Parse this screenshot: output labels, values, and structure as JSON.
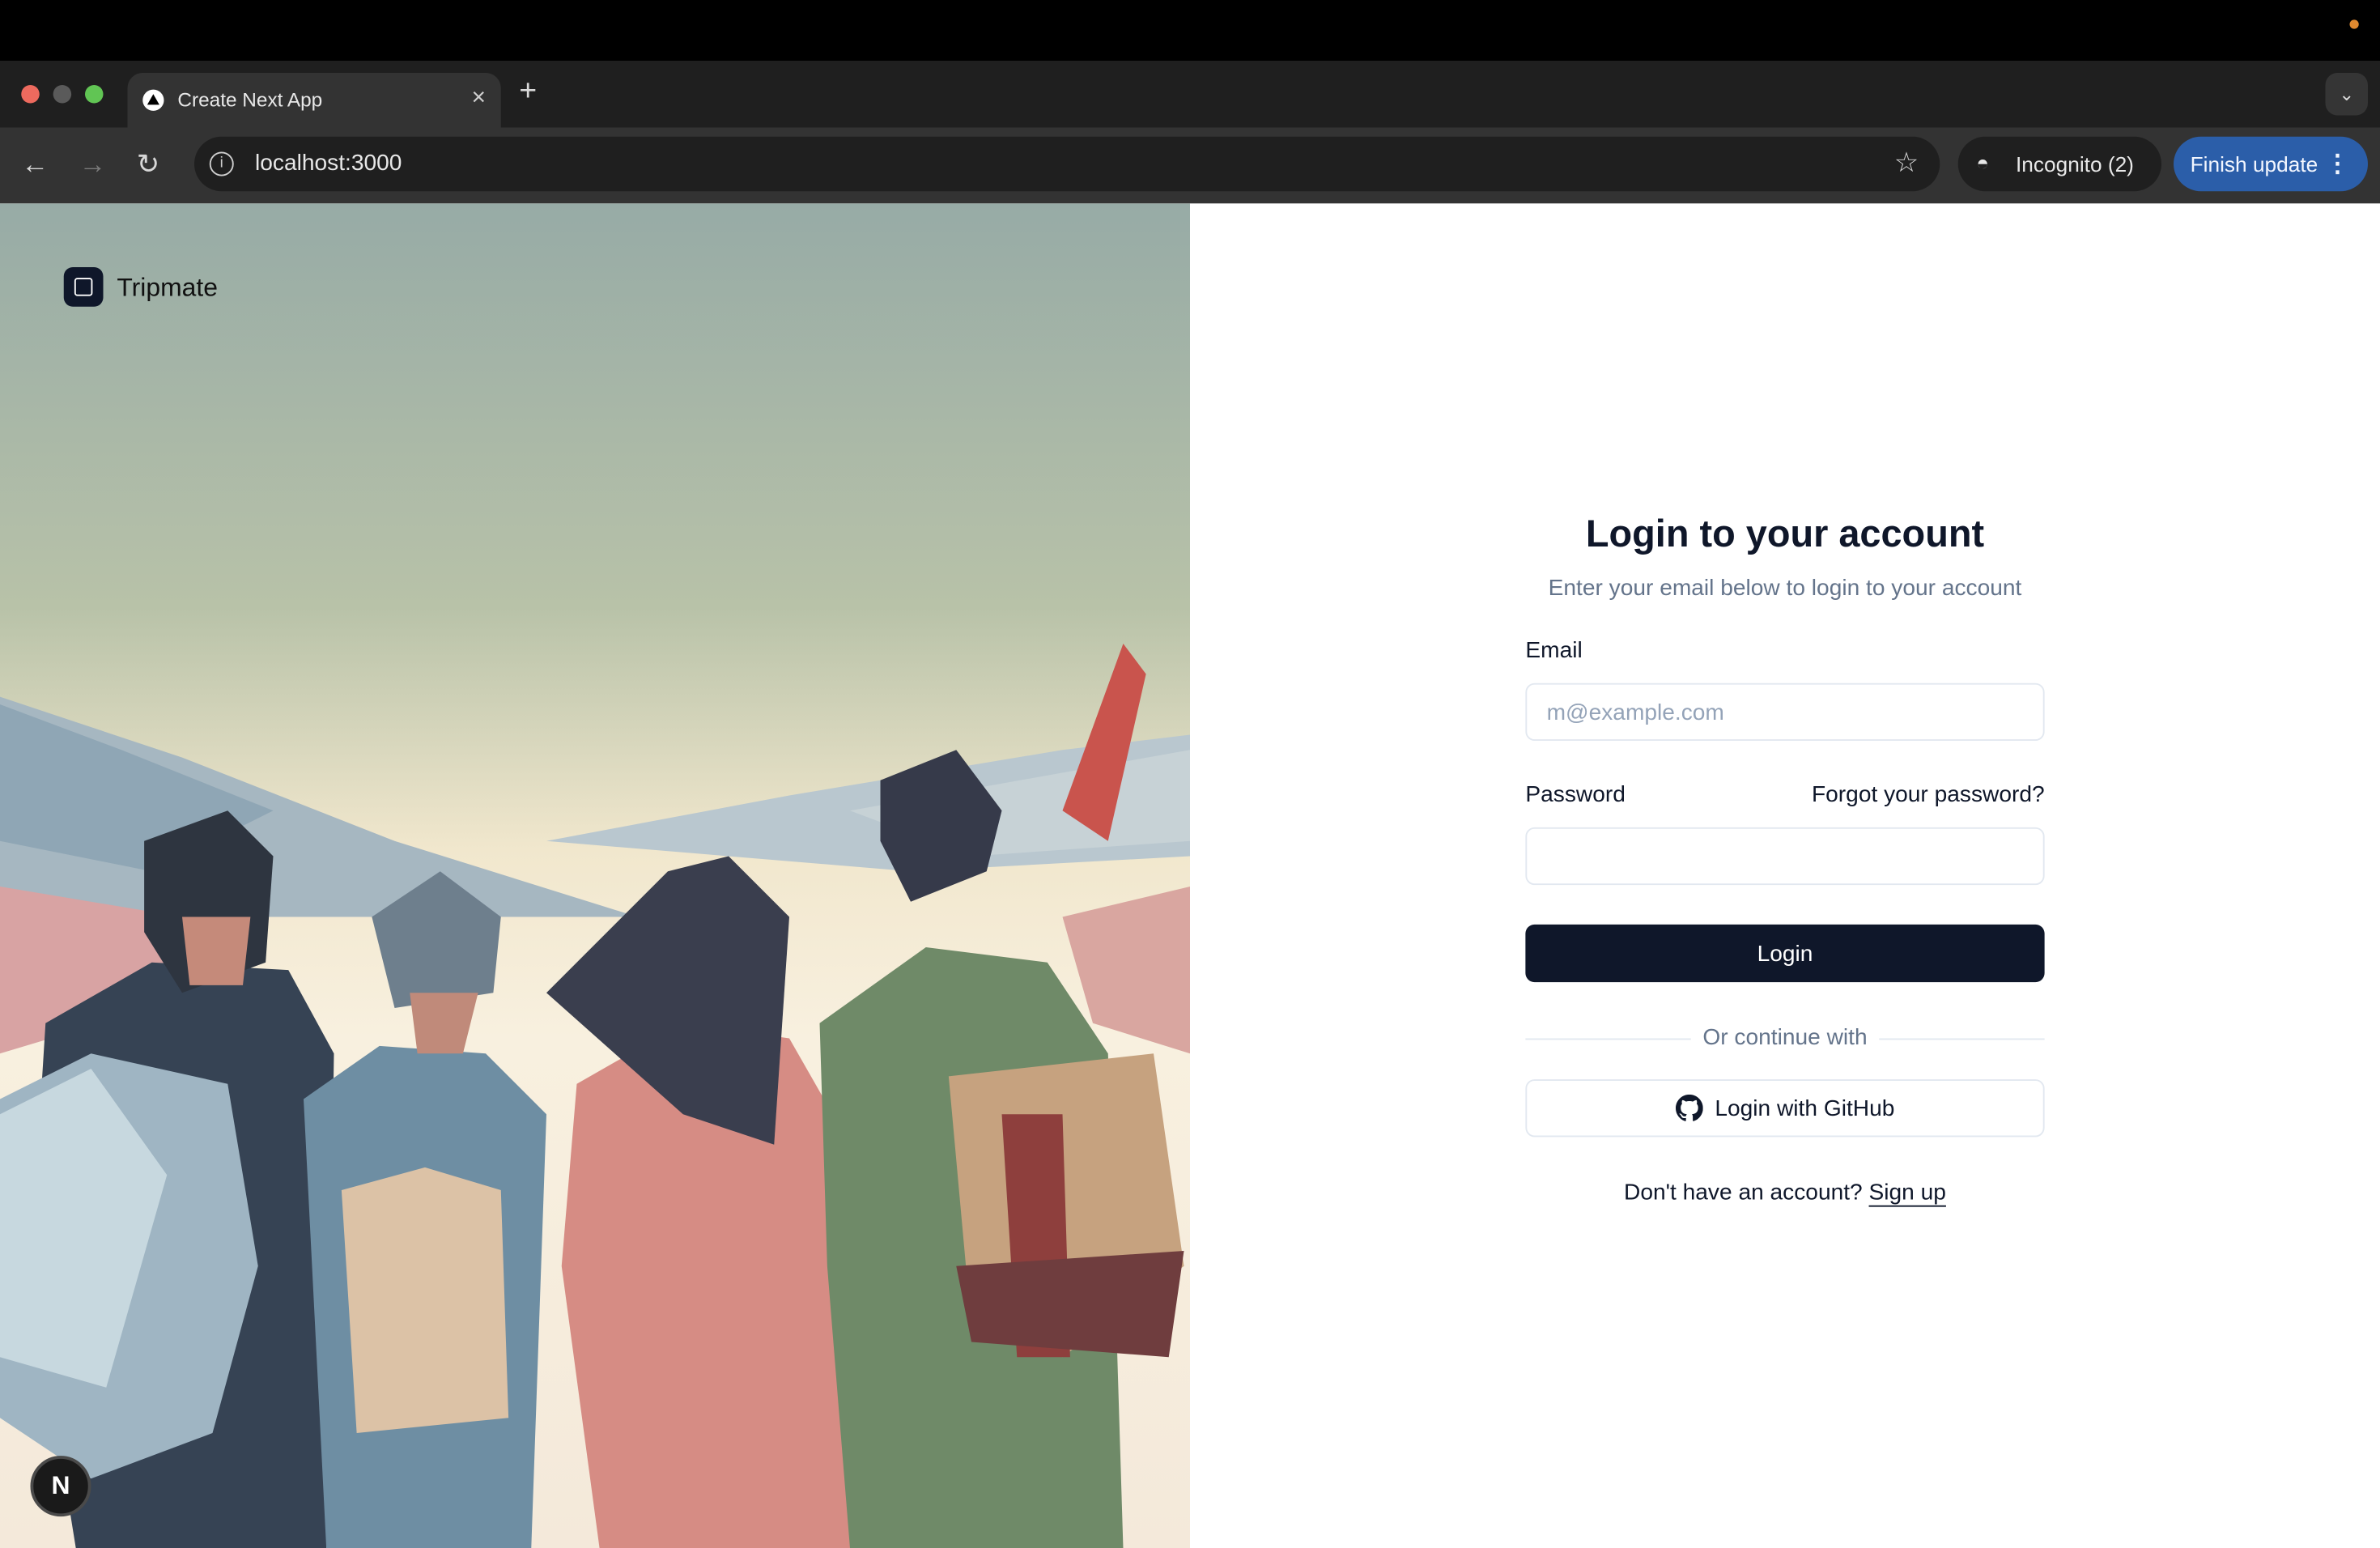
{
  "browser": {
    "tab_title": "Create Next App",
    "tab_close": "×",
    "new_tab": "+",
    "url": "localhost:3000",
    "incognito_label": "Incognito (2)",
    "update_label": "Finish update"
  },
  "hero": {
    "brand_name": "Tripmate",
    "badge": "N"
  },
  "form": {
    "title": "Login to your account",
    "subtitle": "Enter your email below to login to your account",
    "email_label": "Email",
    "email_placeholder": "m@example.com",
    "password_label": "Password",
    "forgot_link": "Forgot your password?",
    "login_button": "Login",
    "divider_text": "Or continue with",
    "github_button": "Login with GitHub",
    "signup_prompt": "Don't have an account?",
    "signup_link": "Sign up"
  },
  "colors": {
    "primary": "#0f172a",
    "muted": "#64748b",
    "update_button": "#2b5ea9"
  },
  "icons": [
    "back-icon",
    "forward-icon",
    "reload-icon",
    "info-icon",
    "star-icon",
    "incognito-icon",
    "more-icon",
    "github-icon",
    "brand-logo-icon"
  ]
}
